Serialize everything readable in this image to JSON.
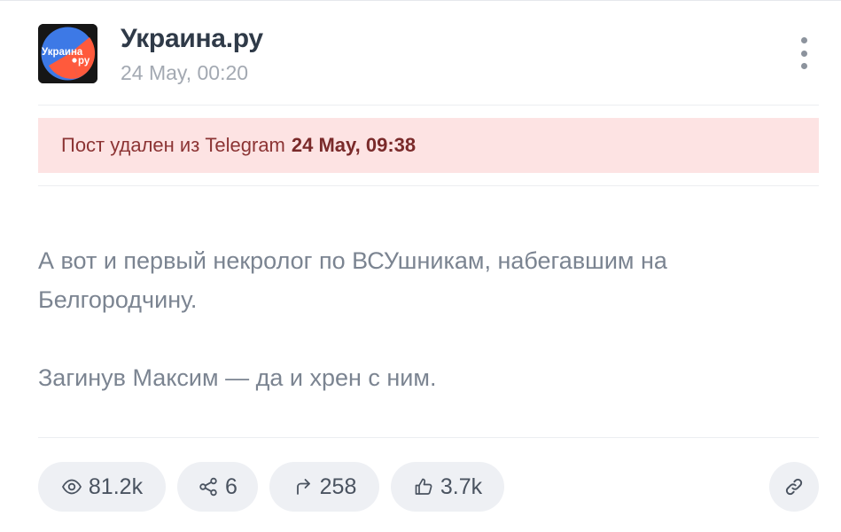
{
  "channel": {
    "name": "Украина.ру",
    "avatar_text_top": "Украина",
    "avatar_text_bottom": "ру",
    "date": "24 May, 00:20"
  },
  "notice": {
    "text": "Пост удален из Telegram",
    "date": "24 May, 09:38",
    "background": "#fde3e3",
    "color": "#8c3434"
  },
  "post": {
    "paragraphs": [
      "А вот и первый некролог по ВСУшникам, набегавшим на Белгородчину.",
      "Загинув Максим — да и хрен с ним."
    ]
  },
  "stats": {
    "views": "81.2k",
    "shares": "6",
    "forwards": "258",
    "likes": "3.7k"
  },
  "icons": {
    "views": "eye-icon",
    "shares": "share-nodes-icon",
    "forwards": "forward-arrow-icon",
    "likes": "thumbs-up-icon",
    "link": "link-icon",
    "more": "vertical-dots-icon"
  }
}
